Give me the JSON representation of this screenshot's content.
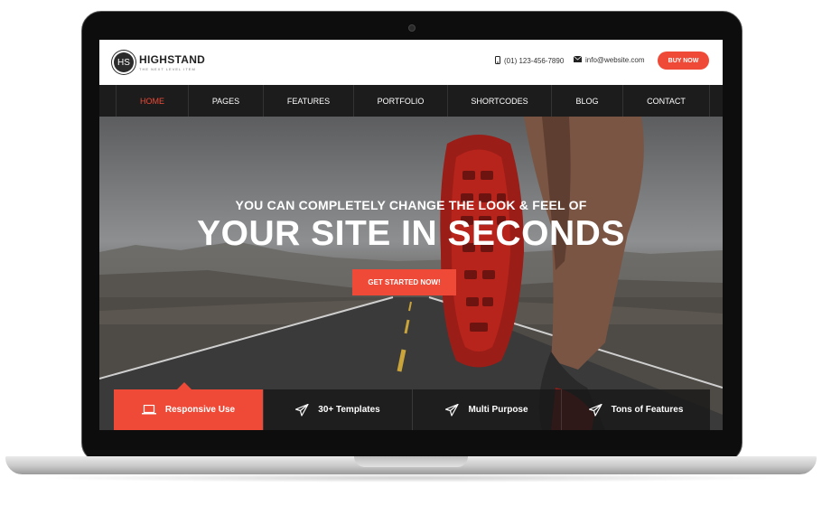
{
  "brand": {
    "monogram": "HS",
    "name": "HIGHSTAND",
    "tagline": "THE NEXT LEVEL ITEM"
  },
  "header": {
    "phone": "(01) 123-456-7890",
    "email": "info@website.com",
    "buy_label": "BUY NOW"
  },
  "nav": {
    "items": [
      {
        "label": "HOME",
        "active": true
      },
      {
        "label": "PAGES"
      },
      {
        "label": "FEATURES"
      },
      {
        "label": "PORTFOLIO"
      },
      {
        "label": "SHORTCODES"
      },
      {
        "label": "BLOG"
      },
      {
        "label": "CONTACT"
      }
    ]
  },
  "hero": {
    "subtitle": "YOU CAN COMPLETELY CHANGE THE LOOK & FEEL OF",
    "title": "YOUR SITE IN SECONDS",
    "cta_label": "GET STARTED NOW!"
  },
  "features": {
    "items": [
      {
        "label": "Responsive Use",
        "icon": "laptop-icon",
        "active": true
      },
      {
        "label": "30+ Templates",
        "icon": "paper-plane-icon"
      },
      {
        "label": "Multi Purpose",
        "icon": "paper-plane-icon"
      },
      {
        "label": "Tons of Features",
        "icon": "paper-plane-icon"
      }
    ]
  },
  "colors": {
    "accent": "#ee4a37",
    "nav_bg": "#1c1c1c"
  }
}
